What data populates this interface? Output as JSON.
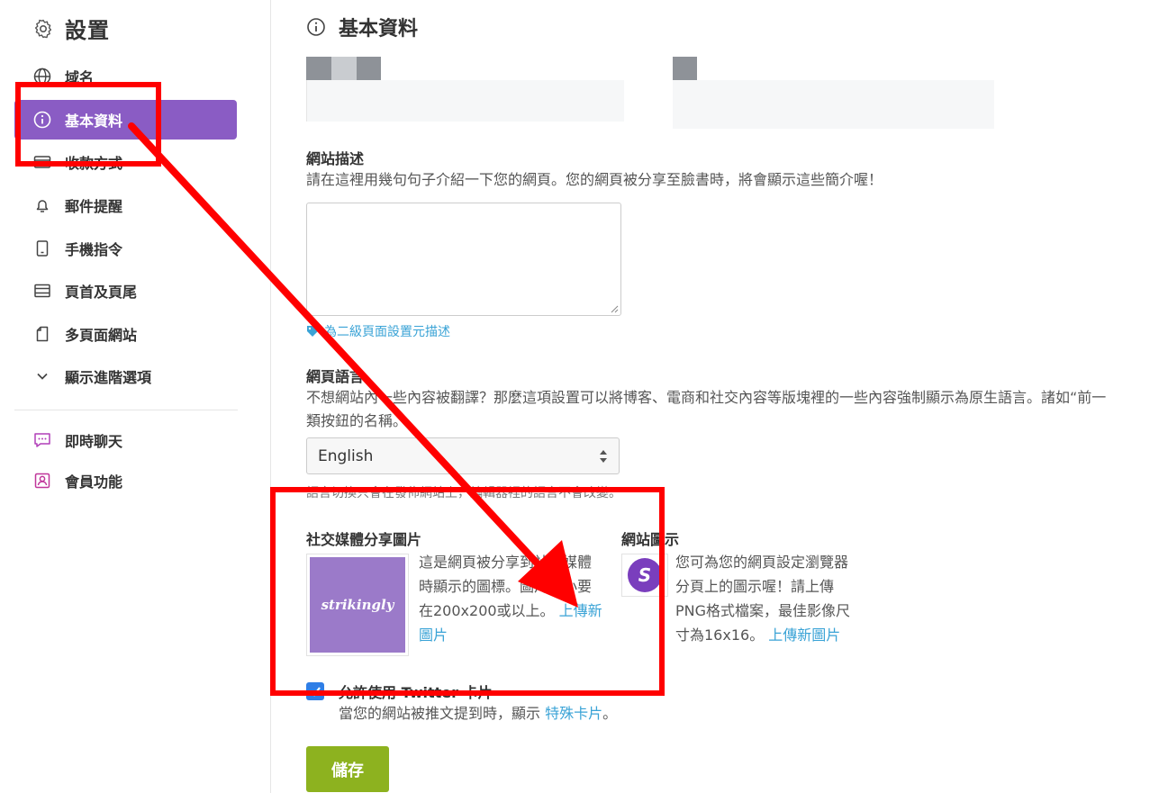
{
  "sidebar": {
    "title": "設置",
    "items": [
      {
        "label": "域名",
        "icon": "globe-icon"
      },
      {
        "label": "基本資料",
        "icon": "info-icon"
      },
      {
        "label": "收款方式",
        "icon": "credit-card-icon"
      },
      {
        "label": "郵件提醒",
        "icon": "bell-icon"
      },
      {
        "label": "手機指令",
        "icon": "mobile-icon"
      },
      {
        "label": "頁首及頁尾",
        "icon": "layout-icon"
      },
      {
        "label": "多頁面網站",
        "icon": "pages-icon"
      },
      {
        "label": "顯示進階選項",
        "icon": "chevron-down-icon"
      },
      {
        "label": "即時聊天",
        "icon": "chat-icon"
      },
      {
        "label": "會員功能",
        "icon": "member-icon"
      }
    ],
    "active_index": 1
  },
  "main": {
    "title": "基本資料",
    "site_description": {
      "label": "網站描述",
      "help": "請在這裡用幾句句子介紹一下您的網頁。您的網頁被分享至臉書時，將會顯示這些簡介喔！",
      "value": "",
      "meta_link": "為二級頁面設置元描述"
    },
    "language": {
      "label": "網頁語言",
      "help_line1": "不想網站內一些內容被翻譯？那麼這項設置可以將博客、電商和社交內容等版塊裡的一些內容強制顯示為原生語言。諸如“前一",
      "help_line2": "類按鈕的名稱。",
      "selected": "English",
      "note": "語言切換只會在發佈網站上，編輯器裡的語言不會改變。"
    },
    "social_image": {
      "label": "社交媒體分享圖片",
      "brand": "strikingly",
      "help_line1": "這是網頁被分享到社交媒體",
      "help_line2": "時顯示的圖標。圖片大小要",
      "help_line3": "在200x200或以上。",
      "upload_a": "上傳新",
      "upload_b": "圖片"
    },
    "favicon": {
      "label": "網站圖示",
      "letter": "S",
      "help_line1": "您可為您的網頁設定瀏覽器",
      "help_line2": "分頁上的圖示喔！請上傳",
      "help_line3": "PNG格式檔案，最佳影像尺",
      "help_line4": "寸為16x16。",
      "upload": "上傳新圖片"
    },
    "twitter": {
      "label": "允許使用 Twitter 卡片",
      "help_prefix": "當您的網站被推文提到時，顯示",
      "help_link": "特殊卡片",
      "help_suffix": "。",
      "checked": true
    },
    "save_label": "儲存"
  },
  "colors": {
    "accent": "#8a5cc4",
    "link": "#3aa3d6",
    "save": "#8db21f",
    "annotation": "#ff0000"
  }
}
